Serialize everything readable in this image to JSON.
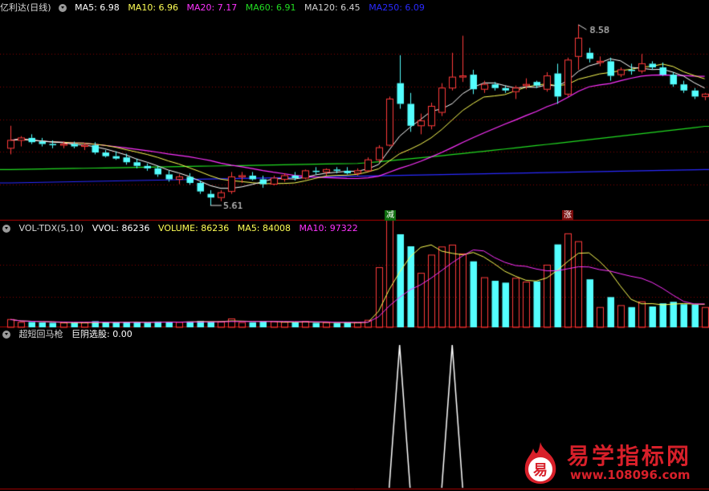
{
  "header_main": {
    "name": "亿利达(日线)",
    "ma": [
      {
        "label": "MA5: 6.98",
        "color": "#ffffff"
      },
      {
        "label": "MA10: 6.96",
        "color": "#ffff55"
      },
      {
        "label": "MA20: 7.17",
        "color": "#ff33ff"
      },
      {
        "label": "MA60: 6.91",
        "color": "#22dd22"
      },
      {
        "label": "MA120: 6.45",
        "color": "#d0d0d0"
      },
      {
        "label": "MA250: 6.09",
        "color": "#2a2aff"
      }
    ]
  },
  "header_vol": {
    "name": "VOL-TDX(5,10)",
    "items": [
      {
        "label": "VVOL: 86236",
        "color": "#ffffff"
      },
      {
        "label": "VOLUME: 86236",
        "color": "#ffff55"
      },
      {
        "label": "MA5: 84008",
        "color": "#ffff55"
      },
      {
        "label": "MA10: 97322",
        "color": "#ff33ff"
      }
    ]
  },
  "header_ind": {
    "name": "超短回马枪",
    "items": [
      {
        "label": "巨阴选股: 0.00",
        "color": "#ffffff"
      }
    ]
  },
  "annotations": {
    "high": "8.58",
    "low": "5.61",
    "mark_reduce": "减",
    "mark_rise": "涨"
  },
  "watermark": {
    "badge": "易",
    "title": "易学指标网",
    "url": "www.108096.com"
  },
  "colors": {
    "up": "#ff3b3b",
    "down": "#54ffff",
    "ma5": "#ffffff",
    "ma10": "#ffff55",
    "ma20": "#ff33ff",
    "ma60": "#22dd22",
    "ma250": "#2a2aff",
    "grid": "#8a0000"
  },
  "chart_data": {
    "type": "candlestick",
    "y_range": [
      5.4,
      8.75
    ],
    "candles": [
      {
        "o": 6.55,
        "h": 6.92,
        "l": 6.45,
        "c": 6.68
      },
      {
        "o": 6.68,
        "h": 6.75,
        "l": 6.58,
        "c": 6.72
      },
      {
        "o": 6.72,
        "h": 6.78,
        "l": 6.62,
        "c": 6.65
      },
      {
        "o": 6.66,
        "h": 6.72,
        "l": 6.58,
        "c": 6.62
      },
      {
        "o": 6.62,
        "h": 6.68,
        "l": 6.55,
        "c": 6.6
      },
      {
        "o": 6.6,
        "h": 6.66,
        "l": 6.55,
        "c": 6.62
      },
      {
        "o": 6.62,
        "h": 6.66,
        "l": 6.55,
        "c": 6.58
      },
      {
        "o": 6.58,
        "h": 6.64,
        "l": 6.52,
        "c": 6.6
      },
      {
        "o": 6.6,
        "h": 6.65,
        "l": 6.45,
        "c": 6.48
      },
      {
        "o": 6.48,
        "h": 6.52,
        "l": 6.4,
        "c": 6.42
      },
      {
        "o": 6.42,
        "h": 6.5,
        "l": 6.36,
        "c": 6.38
      },
      {
        "o": 6.4,
        "h": 6.46,
        "l": 6.28,
        "c": 6.32
      },
      {
        "o": 6.32,
        "h": 6.38,
        "l": 6.22,
        "c": 6.26
      },
      {
        "o": 6.26,
        "h": 6.3,
        "l": 6.18,
        "c": 6.22
      },
      {
        "o": 6.22,
        "h": 6.26,
        "l": 6.08,
        "c": 6.12
      },
      {
        "o": 6.12,
        "h": 6.18,
        "l": 6.0,
        "c": 6.04
      },
      {
        "o": 6.04,
        "h": 6.12,
        "l": 5.96,
        "c": 6.08
      },
      {
        "o": 6.08,
        "h": 6.14,
        "l": 5.95,
        "c": 5.98
      },
      {
        "o": 5.98,
        "h": 6.02,
        "l": 5.8,
        "c": 5.84
      },
      {
        "o": 5.8,
        "h": 5.86,
        "l": 5.61,
        "c": 5.74
      },
      {
        "o": 5.74,
        "h": 5.86,
        "l": 5.68,
        "c": 5.82
      },
      {
        "o": 5.84,
        "h": 6.16,
        "l": 5.8,
        "c": 6.08
      },
      {
        "o": 6.08,
        "h": 6.16,
        "l": 5.98,
        "c": 6.1
      },
      {
        "o": 6.1,
        "h": 6.16,
        "l": 6.02,
        "c": 6.04
      },
      {
        "o": 6.04,
        "h": 6.1,
        "l": 5.9,
        "c": 5.96
      },
      {
        "o": 5.96,
        "h": 6.1,
        "l": 5.94,
        "c": 6.06
      },
      {
        "o": 6.04,
        "h": 6.14,
        "l": 6.0,
        "c": 6.1
      },
      {
        "o": 6.1,
        "h": 6.16,
        "l": 6.02,
        "c": 6.06
      },
      {
        "o": 6.06,
        "h": 6.2,
        "l": 6.04,
        "c": 6.18
      },
      {
        "o": 6.18,
        "h": 6.24,
        "l": 6.12,
        "c": 6.16
      },
      {
        "o": 6.16,
        "h": 6.22,
        "l": 6.1,
        "c": 6.2
      },
      {
        "o": 6.2,
        "h": 6.24,
        "l": 6.14,
        "c": 6.18
      },
      {
        "o": 6.18,
        "h": 6.24,
        "l": 6.12,
        "c": 6.14
      },
      {
        "o": 6.14,
        "h": 6.22,
        "l": 6.1,
        "c": 6.18
      },
      {
        "o": 6.18,
        "h": 6.4,
        "l": 6.16,
        "c": 6.36
      },
      {
        "o": 6.36,
        "h": 6.6,
        "l": 6.32,
        "c": 6.56
      },
      {
        "o": 6.6,
        "h": 7.4,
        "l": 6.58,
        "c": 7.36
      },
      {
        "o": 7.62,
        "h": 8.08,
        "l": 7.2,
        "c": 7.28
      },
      {
        "o": 7.28,
        "h": 7.46,
        "l": 6.82,
        "c": 6.92
      },
      {
        "o": 6.92,
        "h": 7.12,
        "l": 6.78,
        "c": 7.0
      },
      {
        "o": 6.92,
        "h": 7.3,
        "l": 6.86,
        "c": 7.24
      },
      {
        "o": 7.14,
        "h": 7.62,
        "l": 7.08,
        "c": 7.54
      },
      {
        "o": 7.54,
        "h": 8.12,
        "l": 7.5,
        "c": 7.72
      },
      {
        "o": 7.72,
        "h": 8.4,
        "l": 7.64,
        "c": 7.74
      },
      {
        "o": 7.76,
        "h": 7.84,
        "l": 7.44,
        "c": 7.52
      },
      {
        "o": 7.52,
        "h": 7.66,
        "l": 7.46,
        "c": 7.6
      },
      {
        "o": 7.6,
        "h": 7.64,
        "l": 7.5,
        "c": 7.54
      },
      {
        "o": 7.54,
        "h": 7.58,
        "l": 7.46,
        "c": 7.5
      },
      {
        "o": 7.48,
        "h": 7.58,
        "l": 7.36,
        "c": 7.54
      },
      {
        "o": 7.58,
        "h": 7.7,
        "l": 7.52,
        "c": 7.6
      },
      {
        "o": 7.64,
        "h": 7.66,
        "l": 7.54,
        "c": 7.58
      },
      {
        "o": 7.52,
        "h": 7.8,
        "l": 7.48,
        "c": 7.74
      },
      {
        "o": 7.78,
        "h": 7.94,
        "l": 7.28,
        "c": 7.4
      },
      {
        "o": 7.44,
        "h": 8.04,
        "l": 7.4,
        "c": 8.0
      },
      {
        "o": 8.06,
        "h": 8.58,
        "l": 7.84,
        "c": 8.36
      },
      {
        "o": 8.12,
        "h": 8.2,
        "l": 7.96,
        "c": 8.02
      },
      {
        "o": 7.96,
        "h": 8.06,
        "l": 7.9,
        "c": 7.98
      },
      {
        "o": 7.98,
        "h": 8.04,
        "l": 7.66,
        "c": 7.74
      },
      {
        "o": 7.76,
        "h": 7.88,
        "l": 7.72,
        "c": 7.84
      },
      {
        "o": 7.84,
        "h": 7.94,
        "l": 7.76,
        "c": 7.82
      },
      {
        "o": 7.82,
        "h": 8.1,
        "l": 7.78,
        "c": 7.94
      },
      {
        "o": 7.94,
        "h": 7.98,
        "l": 7.84,
        "c": 7.88
      },
      {
        "o": 7.88,
        "h": 7.96,
        "l": 7.74,
        "c": 7.76
      },
      {
        "o": 7.76,
        "h": 7.8,
        "l": 7.56,
        "c": 7.6
      },
      {
        "o": 7.6,
        "h": 7.66,
        "l": 7.46,
        "c": 7.5
      },
      {
        "o": 7.5,
        "h": 7.54,
        "l": 7.36,
        "c": 7.4
      },
      {
        "o": 7.4,
        "h": 7.46,
        "l": 7.34,
        "c": 7.44
      }
    ],
    "ma250": {
      "start": 5.98,
      "end": 6.2
    },
    "ma60": {
      "start": 6.2,
      "mid": 6.3,
      "end": 6.91
    },
    "marks": [
      {
        "index": 37,
        "label": "减",
        "type": "down"
      },
      {
        "index": 54,
        "label": "涨",
        "type": "up"
      }
    ],
    "volume_range": [
      0,
      190000
    ],
    "signal": {
      "peaks": [
        37,
        42
      ]
    }
  }
}
